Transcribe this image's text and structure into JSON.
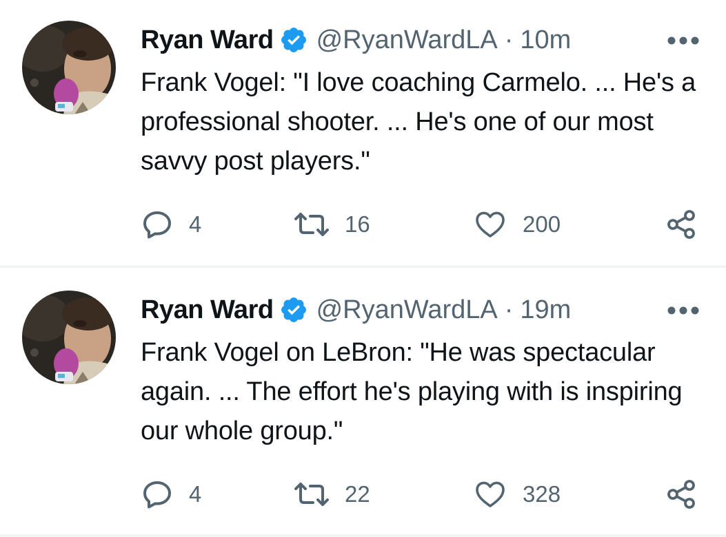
{
  "tweets": [
    {
      "author": "Ryan Ward",
      "handle": "@RyanWardLA",
      "separator": "·",
      "time": "10m",
      "text": "Frank Vogel: \"I love coaching Carmelo. ... He's a professional shooter. ... He's one of our most savvy post players.\"",
      "replies": "4",
      "retweets": "16",
      "likes": "200"
    },
    {
      "author": "Ryan Ward",
      "handle": "@RyanWardLA",
      "separator": "·",
      "time": "19m",
      "text": "Frank Vogel on LeBron: \"He was spectacular again. ... The effort he's playing with is inspiring our whole group.\"",
      "replies": "4",
      "retweets": "22",
      "likes": "328"
    }
  ],
  "icons": {
    "verified": "verified-badge-icon",
    "more": "more-horizontal-icon",
    "reply": "reply-icon",
    "retweet": "retweet-icon",
    "like": "heart-icon",
    "share": "share-icon"
  },
  "colors": {
    "verified_blue": "#1d9bf0",
    "text_primary": "#0f1419",
    "text_secondary": "#536471",
    "divider": "#eff3f4"
  }
}
